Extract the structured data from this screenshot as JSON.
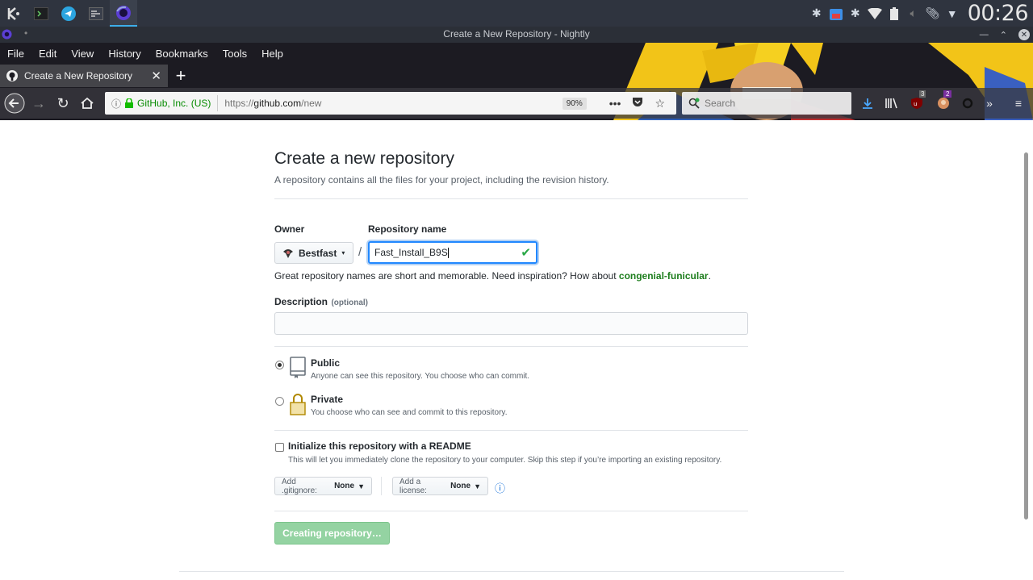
{
  "kde_panel": {
    "clock": "00:26",
    "tasks": [
      "kde-menu",
      "terminal",
      "telegram",
      "system-monitor",
      "firefox-nightly"
    ],
    "badges": {
      "ublock": "3",
      "extension": "2"
    }
  },
  "window": {
    "title": "Create a New Repository - Nightly"
  },
  "menubar": {
    "items": [
      "File",
      "Edit",
      "View",
      "History",
      "Bookmarks",
      "Tools",
      "Help"
    ]
  },
  "tab": {
    "title": "Create a New Repository"
  },
  "urlbar": {
    "identity": "GitHub, Inc. (US)",
    "url_prefix": "https://",
    "url_domain": "github.com",
    "url_path": "/new",
    "zoom": "90%"
  },
  "searchbar": {
    "placeholder": "Search"
  },
  "page": {
    "heading": "Create a new repository",
    "subheading": "A repository contains all the files for your project, including the revision history.",
    "owner_label": "Owner",
    "owner_value": "Bestfast",
    "separator": "/",
    "repo_label": "Repository name",
    "repo_value": "Fast_Install_B9S",
    "hint_prefix": "Great repository names are short and memorable. Need inspiration? How about ",
    "hint_suggestion": "congenial-funicular",
    "hint_suffix": ".",
    "description_label": "Description",
    "description_optional": "(optional)",
    "description_value": "",
    "visibility": {
      "public_title": "Public",
      "public_desc": "Anyone can see this repository. You choose who can commit.",
      "private_title": "Private",
      "private_desc": "You choose who can see and commit to this repository.",
      "selected": "public"
    },
    "readme": {
      "title": "Initialize this repository with a README",
      "desc": "This will let you immediately clone the repository to your computer. Skip this step if you’re importing an existing repository.",
      "checked": false
    },
    "gitignore": {
      "label": "Add .gitignore:",
      "value": "None"
    },
    "license": {
      "label": "Add a license:",
      "value": "None"
    },
    "submit_label": "Creating repository…"
  },
  "colors": {
    "panel_bg": "#2f343f",
    "accent_blue": "#2188ff",
    "success_green": "#28a745",
    "disabled_button": "#94d3a2"
  }
}
